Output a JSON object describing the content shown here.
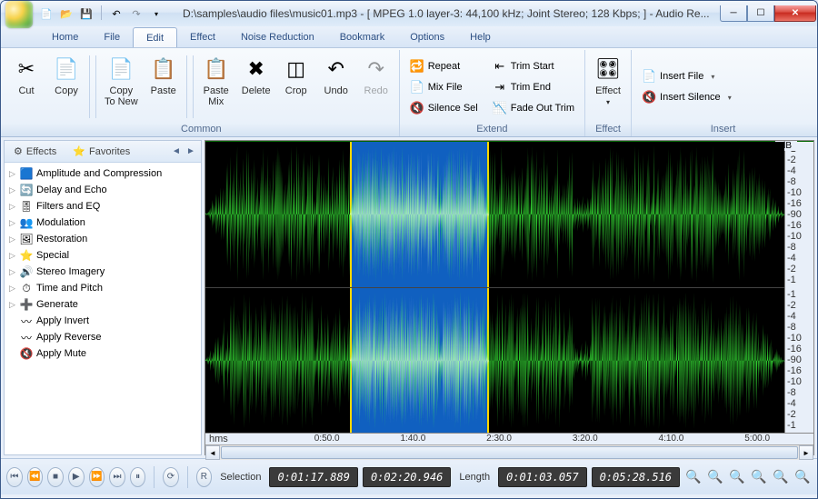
{
  "title": "D:\\samples\\audio files\\music01.mp3 - [ MPEG 1.0 layer-3: 44,100 kHz; Joint Stereo; 128 Kbps;  ] - Audio Re...",
  "menu": [
    "Home",
    "File",
    "Edit",
    "Effect",
    "Noise Reduction",
    "Bookmark",
    "Options",
    "Help"
  ],
  "active_menu": 2,
  "ribbon": {
    "common": {
      "label": "Common",
      "buttons": [
        {
          "id": "cut",
          "label": "Cut"
        },
        {
          "id": "copy",
          "label": "Copy"
        },
        {
          "id": "copy-to-new",
          "label": "Copy\nTo New"
        },
        {
          "id": "paste",
          "label": "Paste"
        },
        {
          "id": "paste-mix",
          "label": "Paste\nMix"
        },
        {
          "id": "delete",
          "label": "Delete"
        },
        {
          "id": "crop",
          "label": "Crop"
        },
        {
          "id": "undo",
          "label": "Undo"
        },
        {
          "id": "redo",
          "label": "Redo"
        }
      ]
    },
    "extend": {
      "label": "Extend",
      "cols": [
        [
          {
            "id": "repeat",
            "label": "Repeat"
          },
          {
            "id": "mix-file",
            "label": "Mix File"
          },
          {
            "id": "silence-sel",
            "label": "Silence Sel"
          }
        ],
        [
          {
            "id": "trim-start",
            "label": "Trim Start"
          },
          {
            "id": "trim-end",
            "label": "Trim End"
          },
          {
            "id": "fade-out-trim",
            "label": "Fade Out Trim"
          }
        ]
      ]
    },
    "effect": {
      "label": "Effect",
      "button": {
        "id": "effect",
        "label": "Effect"
      }
    },
    "insert": {
      "label": "Insert",
      "items": [
        {
          "id": "insert-file",
          "label": "Insert File"
        },
        {
          "id": "insert-silence",
          "label": "Insert Silence"
        }
      ]
    }
  },
  "side_tabs": [
    {
      "id": "effects",
      "label": "Effects"
    },
    {
      "id": "favorites",
      "label": "Favorites"
    }
  ],
  "tree": [
    {
      "exp": true,
      "icon": "🟦",
      "label": "Amplitude and Compression"
    },
    {
      "exp": true,
      "icon": "🔄",
      "label": "Delay and Echo"
    },
    {
      "exp": true,
      "icon": "🎚",
      "label": "Filters and EQ"
    },
    {
      "exp": true,
      "icon": "👥",
      "label": "Modulation"
    },
    {
      "exp": true,
      "icon": "🖼",
      "label": "Restoration"
    },
    {
      "exp": true,
      "icon": "⭐",
      "label": "Special"
    },
    {
      "exp": true,
      "icon": "🔊",
      "label": "Stereo Imagery"
    },
    {
      "exp": true,
      "icon": "⏱",
      "label": "Time and Pitch"
    },
    {
      "exp": true,
      "icon": "➕",
      "label": "Generate"
    },
    {
      "exp": false,
      "icon": "〰",
      "label": "Apply Invert"
    },
    {
      "exp": false,
      "icon": "〰",
      "label": "Apply Reverse"
    },
    {
      "exp": false,
      "icon": "🔇",
      "label": "Apply Mute"
    }
  ],
  "db_scale": [
    "-1",
    "-2",
    "-4",
    "-8",
    "-10",
    "-16",
    "-90",
    "-16",
    "-10",
    "-8",
    "-4",
    "-2",
    "-1"
  ],
  "db_label": "dB",
  "time_hms": "hms",
  "time_ticks": [
    "0:50.0",
    "1:40.0",
    "2:30.0",
    "3:20.0",
    "4:10.0",
    "5:00.0"
  ],
  "transport": {
    "selection_label": "Selection",
    "sel_start": "0:01:17.889",
    "sel_end": "0:02:20.946",
    "length_label": "Length",
    "len_sel": "0:01:03.057",
    "len_total": "0:05:28.516"
  }
}
